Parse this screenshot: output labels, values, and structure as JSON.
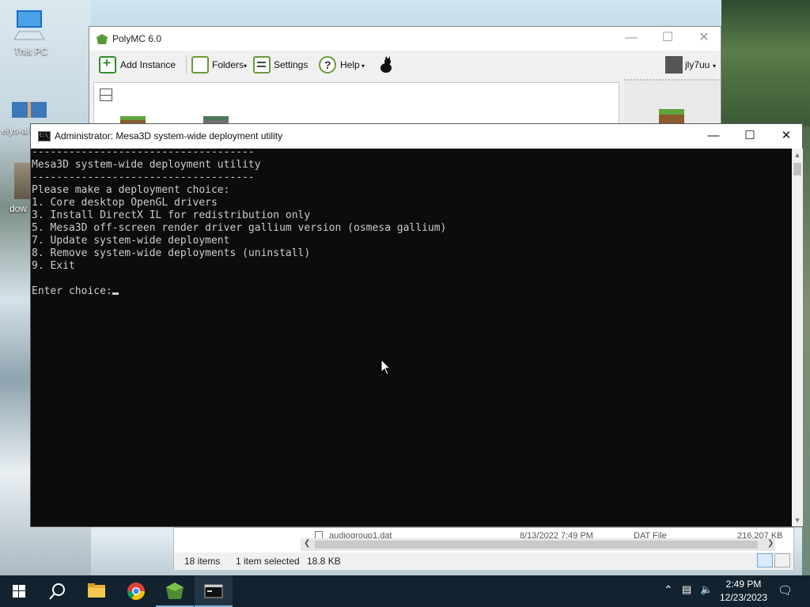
{
  "desktop": {
    "icons": [
      {
        "label": "This PC"
      },
      {
        "label": "elys-ai"
      },
      {
        "label": "dow"
      }
    ]
  },
  "polymc": {
    "title": "PolyMC 6.0",
    "toolbar": {
      "add_instance": "Add Instance",
      "folders": "Folders",
      "settings": "Settings",
      "help": "Help",
      "account": "jly7uu"
    }
  },
  "terminal": {
    "title": "Administrator:  Mesa3D system-wide deployment utility",
    "lines": [
      "------------------------------------",
      "Mesa3D system-wide deployment utility",
      "------------------------------------",
      "Please make a deployment choice:",
      "1. Core desktop OpenGL drivers",
      "3. Install DirectX IL for redistribution only",
      "5. Mesa3D off-screen render driver gallium version (osmesa gallium)",
      "7. Update system-wide deployment",
      "8. Remove system-wide deployments (uninstall)",
      "9. Exit",
      "",
      "Enter choice:"
    ]
  },
  "explorer": {
    "file_row": {
      "name": "audiogroup1.dat",
      "date": "8/13/2022 7:49 PM",
      "type": "DAT File",
      "size": "216,207 KB"
    },
    "status": {
      "items": "18 items",
      "selected": "1 item selected",
      "size": "18.8 KB"
    }
  },
  "taskbar": {
    "clock_time": "2:49 PM",
    "clock_date": "12/23/2023",
    "apps": [
      "start-button",
      "search-button",
      "file-explorer",
      "chrome",
      "polymc",
      "terminal"
    ]
  },
  "colors": {
    "taskbar": "#12222e",
    "terminal_bg": "#0c0c0c",
    "terminal_text": "#cccccc"
  }
}
